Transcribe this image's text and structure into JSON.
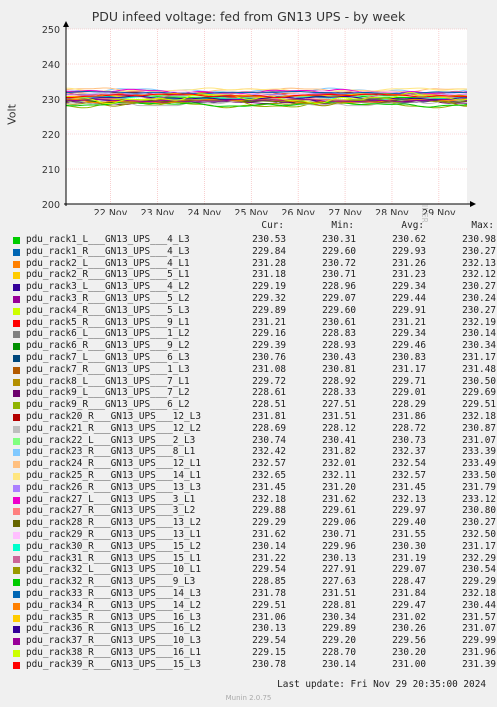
{
  "chart_data": {
    "type": "line",
    "title": "PDU infeed voltage: fed from GN13 UPS - by week",
    "ylabel": "Volt",
    "ylim": [
      200,
      250
    ],
    "yticks": [
      200,
      210,
      220,
      230,
      240,
      250
    ],
    "xticks": [
      "22 Nov",
      "23 Nov",
      "24 Nov",
      "25 Nov",
      "26 Nov",
      "27 Nov",
      "28 Nov",
      "29 Nov"
    ],
    "grid": true,
    "legend_columns": [
      "Cur:",
      "Min:",
      "Avg:",
      "Max:"
    ],
    "series": [
      {
        "name": "pdu_rack1_L___GN13_UPS___4_L3",
        "color": "#00cc00",
        "cur": "230.53",
        "min": "230.31",
        "avg": "230.62",
        "max": "230.98"
      },
      {
        "name": "pdu_rack1_R___GN13_UPS___4_L3",
        "color": "#0066b3",
        "cur": "229.84",
        "min": "229.60",
        "avg": "229.93",
        "max": "230.27"
      },
      {
        "name": "pdu_rack2_L___GN13_UPS___4_L1",
        "color": "#ff8000",
        "cur": "231.28",
        "min": "230.72",
        "avg": "231.26",
        "max": "232.13"
      },
      {
        "name": "pdu_rack2_R___GN13_UPS___5_L1",
        "color": "#ffcc00",
        "cur": "231.18",
        "min": "230.71",
        "avg": "231.23",
        "max": "232.12"
      },
      {
        "name": "pdu_rack3_L___GN13_UPS___4_L2",
        "color": "#330099",
        "cur": "229.19",
        "min": "228.96",
        "avg": "229.34",
        "max": "230.27"
      },
      {
        "name": "pdu_rack3_R___GN13_UPS___5_L2",
        "color": "#990099",
        "cur": "229.32",
        "min": "229.07",
        "avg": "229.44",
        "max": "230.24"
      },
      {
        "name": "pdu_rack4_R___GN13_UPS___5_L3",
        "color": "#ccff00",
        "cur": "229.89",
        "min": "229.60",
        "avg": "229.91",
        "max": "230.27"
      },
      {
        "name": "pdu_rack5_R___GN13_UPS___9_L1",
        "color": "#ff0000",
        "cur": "231.21",
        "min": "230.61",
        "avg": "231.21",
        "max": "232.19"
      },
      {
        "name": "pdu_rack6_L___GN13_UPS___1_L2",
        "color": "#808080",
        "cur": "229.16",
        "min": "228.83",
        "avg": "229.34",
        "max": "230.14"
      },
      {
        "name": "pdu_rack6_R___GN13_UPS___9_L2",
        "color": "#008f00",
        "cur": "229.39",
        "min": "228.93",
        "avg": "229.46",
        "max": "230.34"
      },
      {
        "name": "pdu_rack7_L___GN13_UPS___6_L3",
        "color": "#00487d",
        "cur": "230.76",
        "min": "230.43",
        "avg": "230.83",
        "max": "231.17"
      },
      {
        "name": "pdu_rack7_R___GN13_UPS___1_L3",
        "color": "#b35a00",
        "cur": "231.08",
        "min": "230.81",
        "avg": "231.17",
        "max": "231.48"
      },
      {
        "name": "pdu_rack8_L___GN13_UPS___7_L1",
        "color": "#b38f00",
        "cur": "229.72",
        "min": "228.92",
        "avg": "229.71",
        "max": "230.50"
      },
      {
        "name": "pdu_rack9_L___GN13_UPS___7_L2",
        "color": "#6b006b",
        "cur": "228.61",
        "min": "228.33",
        "avg": "229.01",
        "max": "229.69"
      },
      {
        "name": "pdu_rack9_R___GN13_UPS___6_L2",
        "color": "#8fb300",
        "cur": "228.51",
        "min": "227.51",
        "avg": "228.29",
        "max": "229.51"
      },
      {
        "name": "pdu_rack20_R___GN13_UPS___12_L3",
        "color": "#b30000",
        "cur": "231.81",
        "min": "231.51",
        "avg": "231.86",
        "max": "232.18"
      },
      {
        "name": "pdu_rack21_R___GN13_UPS___12_L2",
        "color": "#bebebe",
        "cur": "228.69",
        "min": "228.12",
        "avg": "228.72",
        "max": "230.87"
      },
      {
        "name": "pdu_rack22_L___GN13_UPS___2_L3",
        "color": "#80ff80",
        "cur": "230.74",
        "min": "230.41",
        "avg": "230.73",
        "max": "231.07"
      },
      {
        "name": "pdu_rack23_R___GN13_UPS___8_L1",
        "color": "#80c9ff",
        "cur": "232.42",
        "min": "231.82",
        "avg": "232.37",
        "max": "233.39"
      },
      {
        "name": "pdu_rack24_R___GN13_UPS___12_L1",
        "color": "#ffc080",
        "cur": "232.57",
        "min": "232.01",
        "avg": "232.54",
        "max": "233.49"
      },
      {
        "name": "pdu_rack25_R___GN13_UPS___14_L1",
        "color": "#ffe680",
        "cur": "232.65",
        "min": "232.11",
        "avg": "232.57",
        "max": "233.50"
      },
      {
        "name": "pdu_rack26_R___GN13_UPS___13_L3",
        "color": "#aa80ff",
        "cur": "231.45",
        "min": "231.20",
        "avg": "231.45",
        "max": "231.79"
      },
      {
        "name": "pdu_rack27_L___GN13_UPS___3_L1",
        "color": "#ee00cc",
        "cur": "232.18",
        "min": "231.62",
        "avg": "232.13",
        "max": "233.12"
      },
      {
        "name": "pdu_rack27_R___GN13_UPS___3_L2",
        "color": "#ff8080",
        "cur": "229.88",
        "min": "229.61",
        "avg": "229.97",
        "max": "230.80"
      },
      {
        "name": "pdu_rack28_R___GN13_UPS___13_L2",
        "color": "#666600",
        "cur": "229.29",
        "min": "229.06",
        "avg": "229.40",
        "max": "230.27"
      },
      {
        "name": "pdu_rack29_R___GN13_UPS___13_L1",
        "color": "#ffbfff",
        "cur": "231.62",
        "min": "230.71",
        "avg": "231.55",
        "max": "232.50"
      },
      {
        "name": "pdu_rack30_R___GN13_UPS___15_L2",
        "color": "#00ffcc",
        "cur": "230.14",
        "min": "229.96",
        "avg": "230.30",
        "max": "231.17"
      },
      {
        "name": "pdu_rack31_R___GN13_UPS___15_L1",
        "color": "#cc6699",
        "cur": "231.22",
        "min": "230.13",
        "avg": "231.19",
        "max": "232.29"
      },
      {
        "name": "pdu_rack32_L___GN13_UPS___10_L1",
        "color": "#999900",
        "cur": "229.54",
        "min": "227.91",
        "avg": "229.07",
        "max": "230.54"
      },
      {
        "name": "pdu_rack32_R___GN13_UPS___9_L3",
        "color": "#00cc00",
        "cur": "228.85",
        "min": "227.63",
        "avg": "228.47",
        "max": "229.29"
      },
      {
        "name": "pdu_rack33_R___GN13_UPS___14_L3",
        "color": "#0066b3",
        "cur": "231.78",
        "min": "231.51",
        "avg": "231.84",
        "max": "232.18"
      },
      {
        "name": "pdu_rack34_R___GN13_UPS___14_L2",
        "color": "#ff8000",
        "cur": "229.51",
        "min": "228.81",
        "avg": "229.47",
        "max": "230.44"
      },
      {
        "name": "pdu_rack35_R___GN13_UPS___16_L3",
        "color": "#ffcc00",
        "cur": "231.06",
        "min": "230.34",
        "avg": "231.02",
        "max": "231.57"
      },
      {
        "name": "pdu_rack36_R___GN13_UPS___16_L2",
        "color": "#330099",
        "cur": "230.13",
        "min": "229.89",
        "avg": "230.26",
        "max": "231.07"
      },
      {
        "name": "pdu_rack37_R___GN13_UPS___10_L3",
        "color": "#990099",
        "cur": "229.54",
        "min": "229.20",
        "avg": "229.56",
        "max": "229.99"
      },
      {
        "name": "pdu_rack38_R___GN13_UPS___16_L1",
        "color": "#ccff00",
        "cur": "229.15",
        "min": "228.70",
        "avg": "230.20",
        "max": "231.96"
      },
      {
        "name": "pdu_rack39_R___GN13_UPS___15_L3",
        "color": "#ff0000",
        "cur": "230.78",
        "min": "230.14",
        "avg": "231.00",
        "max": "231.39"
      }
    ]
  },
  "watermark": "RRDTOOL / TOBI OETIKER",
  "footer": "Last update: Fri Nov 29 20:35:00 2024",
  "munin_version": "Munin 2.0.75"
}
